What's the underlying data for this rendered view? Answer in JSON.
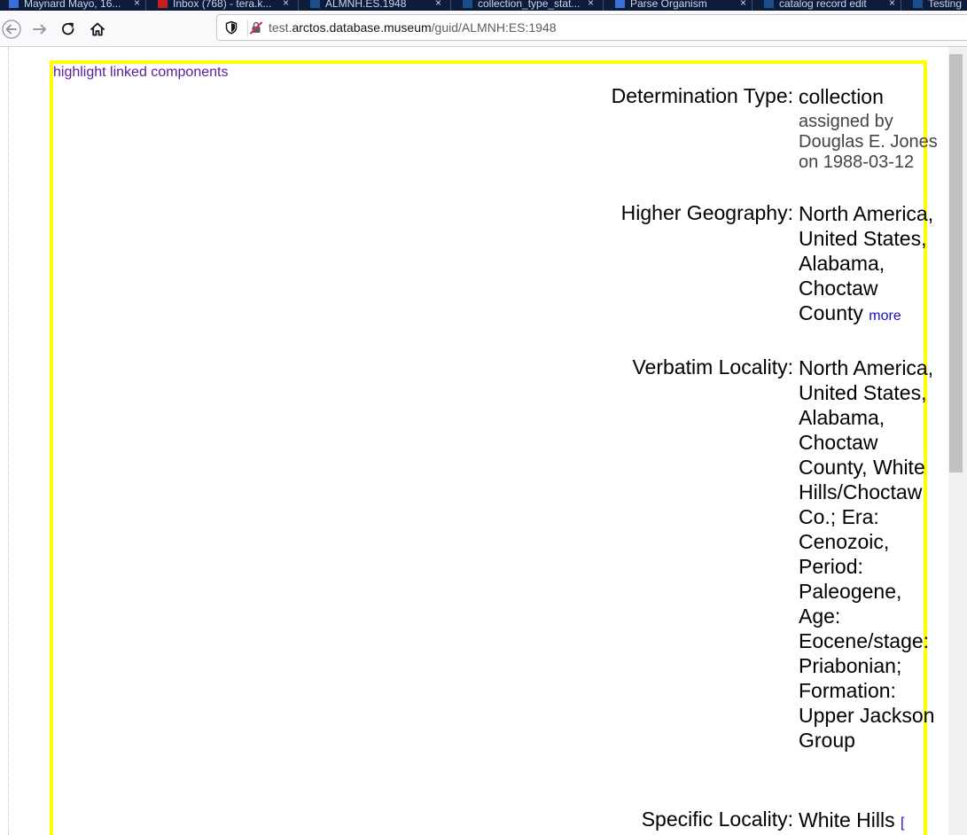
{
  "tabs": [
    {
      "label": "Maynard Mayo, 16...",
      "color": "#3b6fd8"
    },
    {
      "label": "Inbox (768) - tera.k...",
      "color": "#c5221f"
    },
    {
      "label": "ALMNH.ES.1948",
      "color": "#1b4e8c"
    },
    {
      "label": "collection_type_stat...",
      "color": "#1b4e8c"
    },
    {
      "label": "Parse Organism",
      "color": "#3b6fd8"
    },
    {
      "label": "catalog record edit",
      "color": "#1b4e8c"
    },
    {
      "label": "Testing",
      "color": "#1b4e8c"
    }
  ],
  "tab_close": "×",
  "url": {
    "prefix": "test.",
    "host": "arctos.database.museum",
    "path": "/guid/ALMNH:ES:1948"
  },
  "page": {
    "highlight_link": "highlight linked components",
    "determination_type": {
      "label": "Determination Type:",
      "value": "collection",
      "assigned_by": "assigned by Douglas E. Jones on 1988-03-12"
    },
    "higher_geography": {
      "label": "Higher Geography:",
      "value": "North America, United States, Alabama, Choctaw County",
      "more": "more"
    },
    "verbatim_locality": {
      "label": "Verbatim Locality:",
      "value": "North America, United States, Alabama, Choctaw County, White Hills/Choctaw Co.; Era: Cenozoic, Period: Paleogene, Age: Eocene/stage: Priabonian; Formation: Upper Jackson Group"
    },
    "specific_locality": {
      "label": "Specific Locality:",
      "value": "White Hills",
      "bracket": "["
    }
  },
  "colors": {
    "frame": "#ffff00",
    "visited_link": "#5a1a9c",
    "link": "#1a0dcc",
    "tab_bg": "#0c1c3a"
  },
  "icons": [
    "back-arrow-icon",
    "forward-arrow-icon",
    "reload-icon",
    "home-icon",
    "shield-icon",
    "insecure-lock-icon"
  ]
}
